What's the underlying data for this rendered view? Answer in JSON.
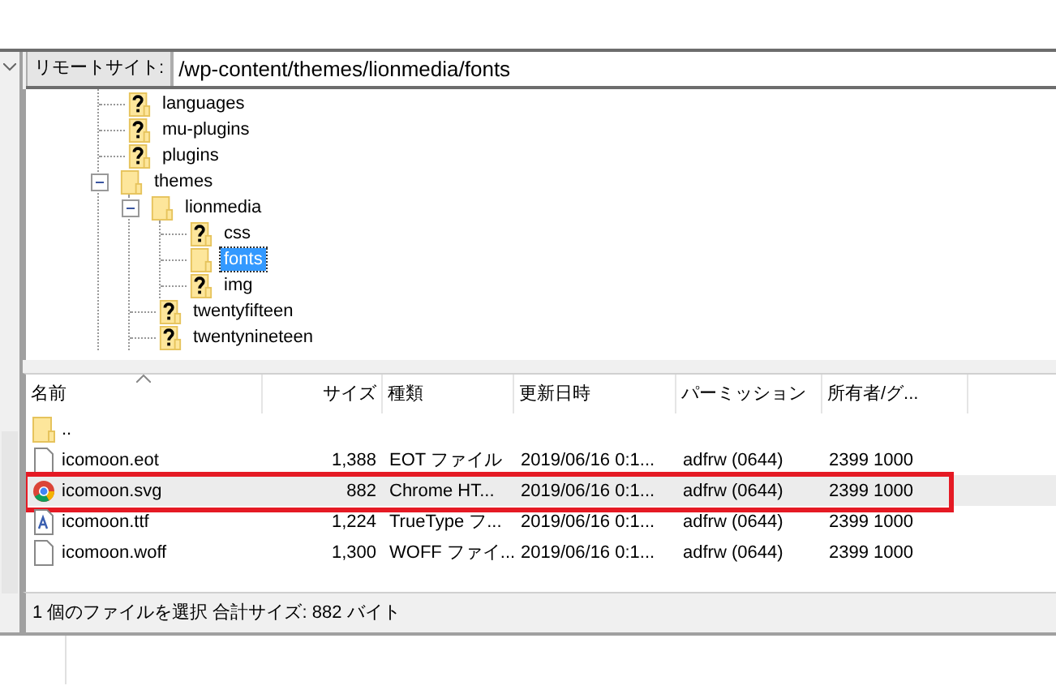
{
  "remote_site": {
    "label": "リモートサイト:",
    "path": "/wp-content/themes/lionmedia/fonts"
  },
  "tree": [
    {
      "label": "languages",
      "kind": "unknown",
      "expanded": false,
      "selected": false
    },
    {
      "label": "mu-plugins",
      "kind": "unknown",
      "expanded": false,
      "selected": false
    },
    {
      "label": "plugins",
      "kind": "unknown",
      "expanded": false,
      "selected": false
    },
    {
      "label": "themes",
      "kind": "folder",
      "expanded": true,
      "selected": false,
      "children": [
        {
          "label": "lionmedia",
          "kind": "folder",
          "expanded": true,
          "selected": false,
          "children": [
            {
              "label": "css",
              "kind": "unknown",
              "expanded": false,
              "selected": false
            },
            {
              "label": "fonts",
              "kind": "folder",
              "expanded": false,
              "selected": true
            },
            {
              "label": "img",
              "kind": "unknown",
              "expanded": false,
              "selected": false
            }
          ]
        },
        {
          "label": "twentyfifteen",
          "kind": "unknown",
          "expanded": false,
          "selected": false
        },
        {
          "label": "twentynineteen",
          "kind": "unknown",
          "expanded": false,
          "selected": false
        }
      ]
    }
  ],
  "table": {
    "columns": [
      "名前",
      "サイズ",
      "種類",
      "更新日時",
      "パーミッション",
      "所有者/グ..."
    ],
    "rows": [
      {
        "kind": "folder",
        "name": "..",
        "size": "",
        "type": "",
        "modified": "",
        "permissions": "",
        "owner": "",
        "selected": false,
        "highlighted": false
      },
      {
        "kind": "file",
        "name": "icomoon.eot",
        "size": "1,388",
        "type": "EOT ファイル",
        "modified": "2019/06/16 0:1...",
        "permissions": "adfrw (0644)",
        "owner": "2399 1000",
        "selected": false,
        "highlighted": false
      },
      {
        "kind": "browser",
        "name": "icomoon.svg",
        "size": "882",
        "type": "Chrome HT...",
        "modified": "2019/06/16 0:1...",
        "permissions": "adfrw (0644)",
        "owner": "2399 1000",
        "selected": true,
        "highlighted": true
      },
      {
        "kind": "font",
        "name": "icomoon.ttf",
        "size": "1,224",
        "type": "TrueType フ...",
        "modified": "2019/06/16 0:1...",
        "permissions": "adfrw (0644)",
        "owner": "2399 1000",
        "selected": false,
        "highlighted": false
      },
      {
        "kind": "file",
        "name": "icomoon.woff",
        "size": "1,300",
        "type": "WOFF ファイ...",
        "modified": "2019/06/16 0:1...",
        "permissions": "adfrw (0644)",
        "owner": "2399 1000",
        "selected": false,
        "highlighted": false
      }
    ]
  },
  "status_bar": "1 個のファイルを選択 合計サイズ: 882 バイト"
}
